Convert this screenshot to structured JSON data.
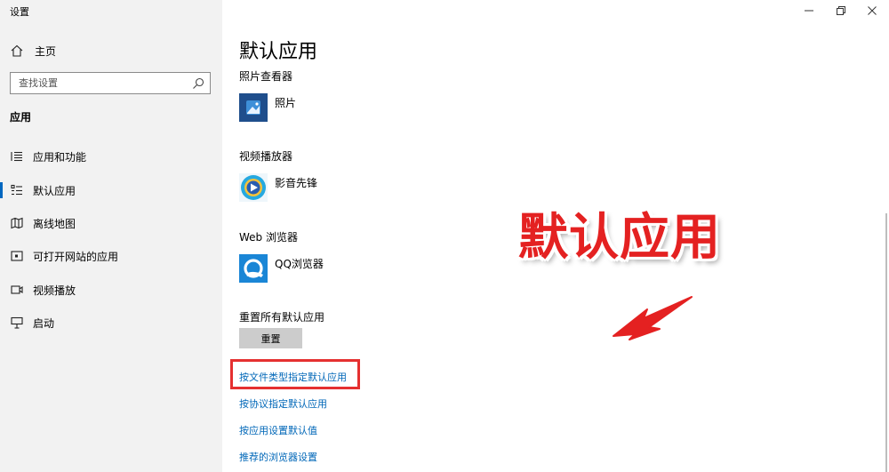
{
  "window": {
    "title": "设置"
  },
  "sidebar": {
    "home_label": "主页",
    "search_placeholder": "查找设置",
    "section_title": "应用",
    "items": [
      {
        "label": "应用和功能",
        "icon": "list-icon",
        "active": false
      },
      {
        "label": "默认应用",
        "icon": "default-apps-icon",
        "active": true
      },
      {
        "label": "离线地图",
        "icon": "map-icon",
        "active": false
      },
      {
        "label": "可打开网站的应用",
        "icon": "web-apps-icon",
        "active": false
      },
      {
        "label": "视频播放",
        "icon": "video-icon",
        "active": false
      },
      {
        "label": "启动",
        "icon": "startup-icon",
        "active": false
      }
    ]
  },
  "main": {
    "title": "默认应用",
    "categories": [
      {
        "label": "照片查看器",
        "app": "照片",
        "icon": "photos-icon",
        "color": "#1f5fa8"
      },
      {
        "label": "视频播放器",
        "app": "影音先锋",
        "icon": "video-player-icon",
        "color": "#1e90c8"
      },
      {
        "label": "Web 浏览器",
        "app": "QQ浏览器",
        "icon": "qq-browser-icon",
        "color": "#1a86d6"
      }
    ],
    "reset_label": "重置所有默认应用",
    "reset_button": "重置",
    "links": [
      "按文件类型指定默认应用",
      "按协议指定默认应用",
      "按应用设置默认值",
      "推荐的浏览器设置"
    ]
  },
  "annotation": {
    "text": "默认应用",
    "color": "#e42121"
  },
  "colors": {
    "accent": "#0067c0",
    "link": "#0067b8",
    "sidebar_bg": "#f2f2f2",
    "highlight": "#e53030"
  }
}
